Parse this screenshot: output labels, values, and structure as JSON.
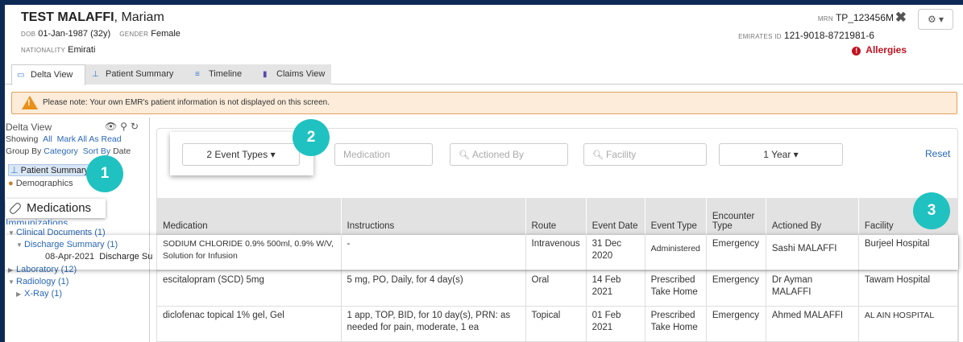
{
  "patient": {
    "last_name": "TEST MALAFFI",
    "first_name": "Mariam",
    "dob_label": "DOB",
    "dob": "01-Jan-1987 (32y)",
    "gender_label": "GENDER",
    "gender": "Female",
    "nationality_label": "NATIONALITY",
    "nationality": "Emirati",
    "mrn_label": "MRN",
    "mrn": "TP_123456M",
    "eid_label": "EMIRATES ID",
    "eid": "121-9018-8721981-6",
    "allergies": "Allergies"
  },
  "tabs": [
    {
      "label": "Delta View",
      "icon": "delta-icon"
    },
    {
      "label": "Patient Summary",
      "icon": "summary-icon"
    },
    {
      "label": "Timeline",
      "icon": "timeline-icon"
    },
    {
      "label": "Claims View",
      "icon": "claims-icon"
    }
  ],
  "banner": "Please note: Your own EMR's patient information is not displayed on this screen.",
  "sidebar": {
    "title": "Delta View",
    "showing_label": "Showing",
    "all": "All",
    "mark_all": "Mark All As Read",
    "group_by_label": "Group By",
    "group_by": "Category",
    "sort_by": "Sort By",
    "sort_val": "Date",
    "patient_summary": "Patient Summary",
    "demographics": "Demographics",
    "medications": "Medications",
    "immunizations": "Immunizations",
    "clinical_docs": "Clinical Documents (1)",
    "discharge_summary": "Discharge Summary (1)",
    "discharge_date": "08-Apr-2021",
    "discharge_item": "Discharge Su",
    "laboratory": "Laboratory (12)",
    "radiology": "Radiology (1)",
    "xray": "X-Ray (1)"
  },
  "filters": {
    "event_types": "2 Event Types",
    "medication_ph": "Medication",
    "actioned_by_ph": "Actioned By",
    "facility_ph": "Facility",
    "period": "1 Year",
    "reset": "Reset"
  },
  "table": {
    "headers": [
      "Medication",
      "Instructions",
      "Route",
      "Event Date",
      "Event Type",
      "Encounter Type",
      "Actioned By",
      "Facility"
    ],
    "rows": [
      [
        "SODIUM CHLORIDE 0.9% 500ml, 0.9% W/V, Solution for Infusion",
        "-",
        "Intravenous",
        "31 Dec 2020",
        "Administered",
        "Emergency",
        "Sashi MALAFFI",
        "Burjeel Hospital"
      ],
      [
        "escitalopram (SCD) 5mg",
        "5 mg, PO, Daily, for 4 day(s)",
        "Oral",
        "14 Feb 2021",
        "Prescribed Take Home",
        "Emergency",
        "Dr Ayman MALAFFI",
        "Tawam Hospital"
      ],
      [
        "diclofenac topical 1% gel, Gel",
        "1 app, TOP, BID, for 10 day(s), PRN: as needed for pain, moderate, 1 ea",
        "Topical",
        "01 Feb 2021",
        "Prescribed Take Home",
        "Emergency",
        "Ahmed MALAFFI",
        "AL AIN HOSPITAL"
      ]
    ]
  },
  "callouts": [
    "1",
    "2",
    "3"
  ],
  "colors": {
    "accent": "#1fc2c0",
    "link": "#2a67b8",
    "alert": "#c1121f",
    "warning": "#e8901a"
  }
}
